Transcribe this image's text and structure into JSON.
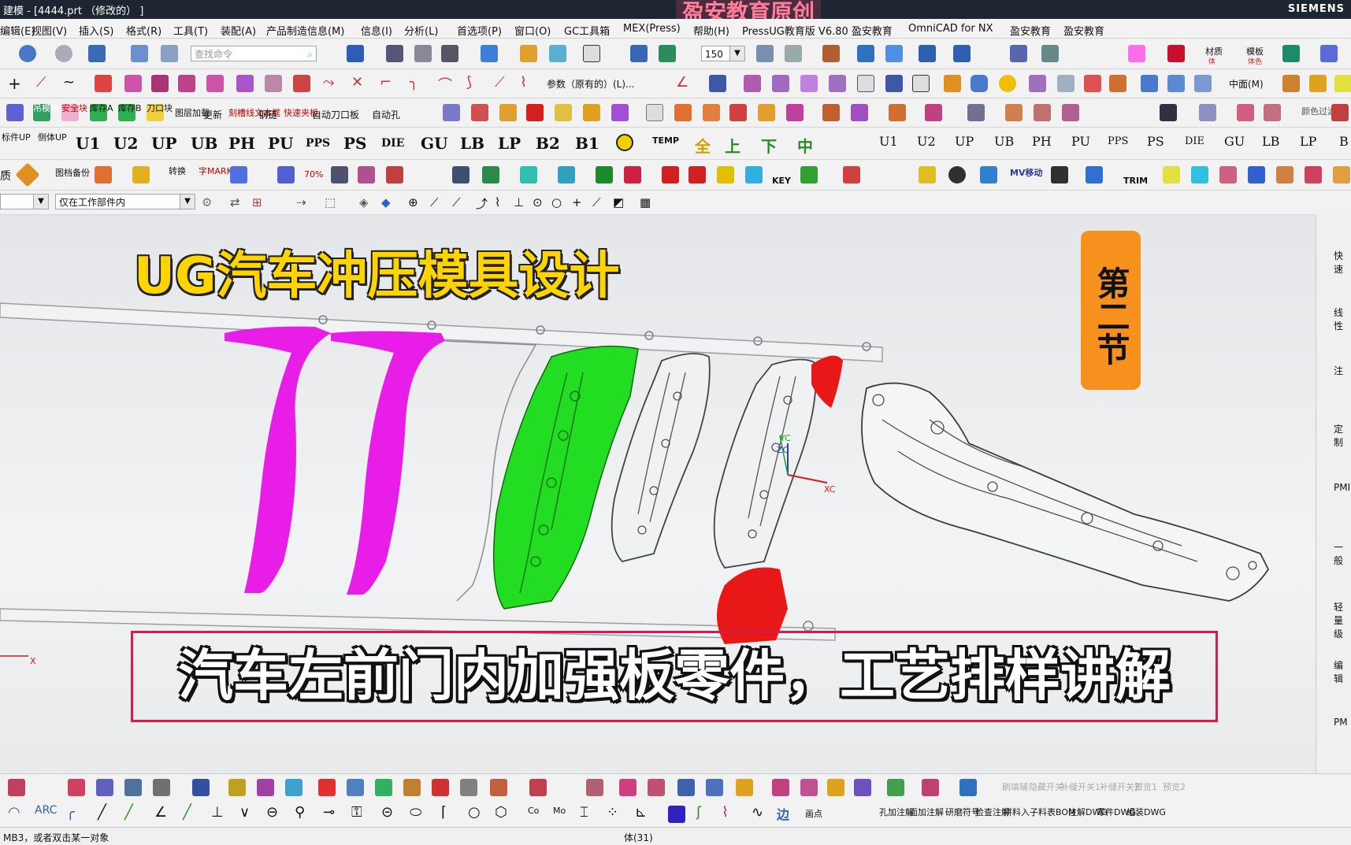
{
  "window": {
    "title": "建模 - [4444.prt （修改的） ]",
    "brand": "SIEMENS",
    "watermark": "盈安教育原创"
  },
  "menu": [
    "编辑(E)",
    "视图(V)",
    "插入(S)",
    "格式(R)",
    "工具(T)",
    "装配(A)",
    "产品制造信息(M)",
    "信息(I)",
    "分析(L)",
    "首选项(P)",
    "窗口(O)",
    "GC工具箱",
    "MEX(Press)",
    "帮助(H)",
    "PressUG教育版 V6.80 盈安教育",
    "OmniCAD for NX",
    "盈安教育",
    "盈安教育"
  ],
  "toolbar1": {
    "search_placeholder": "查找命令",
    "scale_value": "150",
    "material_label": "材质",
    "material_sub": "体",
    "template_label": "模板",
    "template_sub": "体色"
  },
  "toolbar2": {
    "param_label": "参数（原有的）(L)...",
    "middle_label": "中面(M)"
  },
  "toolbar3": {
    "labels": [
      "吊模块",
      "安全块",
      "库存A",
      "库存B",
      "刀口块",
      "图层加载",
      "更新",
      "刻槽线文本框",
      "钢链",
      "快速夹板",
      "自动刀口板",
      "自动孔"
    ],
    "color_filter": "颜色过滤"
  },
  "toolbar4": {
    "left_tags": [
      "标件UP",
      "侧体UP"
    ],
    "codes": [
      "U1",
      "U2",
      "UP",
      "UB",
      "PH",
      "PU",
      "PPS",
      "PS",
      "DIE",
      "GU",
      "LB",
      "LP",
      "B2",
      "B1"
    ],
    "temp_label": "TEMP",
    "gold_labels": [
      "全",
      "上",
      "下",
      "中"
    ],
    "right_codes": [
      "U1",
      "U2",
      "UP",
      "UB",
      "PH",
      "PU",
      "PPS",
      "PS",
      "DIE",
      "GU",
      "LB",
      "LP",
      "B"
    ],
    "right_sub": "移"
  },
  "toolbar5": {
    "labels": [
      "质",
      "图档备份",
      "转换",
      "字MARK",
      "70%",
      "KEY",
      "MV移动",
      "TRIM"
    ]
  },
  "selbar": {
    "filter_value": "",
    "scope_value": "仅在工作部件内"
  },
  "viewport": {
    "headline": "UG汽车冲压模具设计",
    "badge": "第二节",
    "caption": "汽车左前门内加强板零件，工艺排样讲解",
    "axis_zc": "ZC",
    "axis_yc": "YC",
    "axis_xc": "XC",
    "axis_x": "X"
  },
  "right_panel": [
    "快速",
    "线性",
    "注",
    "定制",
    "PMI",
    "一般",
    "轻量级",
    "编辑",
    "PM"
  ],
  "bottom_toolbar": {
    "labels": [
      "画点",
      "孔加注解",
      "面加注解",
      "研磨符号",
      "检查注解",
      "拼料入子",
      "料表BOM",
      "注解DWG",
      "零件DWG",
      "组装DWG"
    ],
    "gray_labels": [
      "刷填辅",
      "隐藏开关",
      "补缝开关1",
      "补缝开关2",
      "预览1",
      "预览2"
    ]
  },
  "status": {
    "left": "MB3，或者双击某一对象",
    "center": "体(31)"
  },
  "colors": {
    "magenta": "#e81ee8",
    "green": "#22dd22",
    "red": "#e81818",
    "yellow": "#ffd400",
    "badge": "#f7911d",
    "caption_border": "#d81b47"
  }
}
